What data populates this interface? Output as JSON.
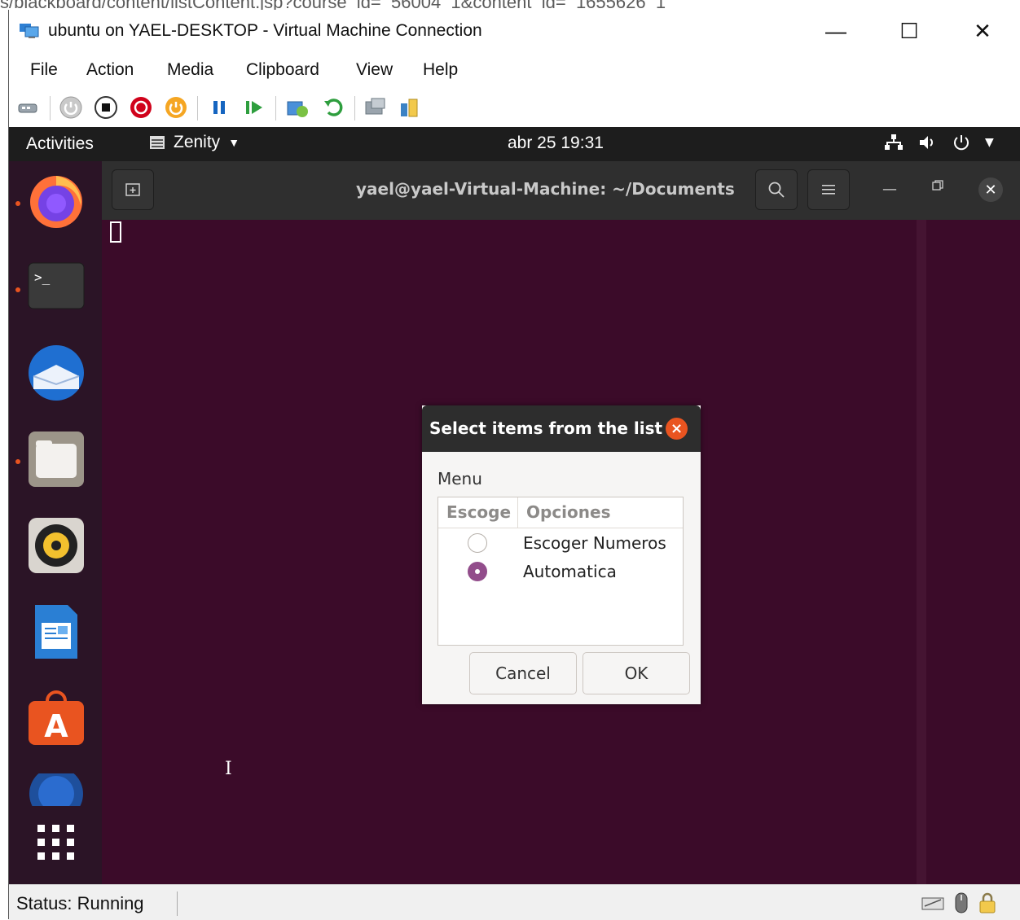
{
  "behind_window": {
    "url_fragment": "s/blackboard/content/listContent.jsp?course_id=_56004_1&content_id=_1655626_1"
  },
  "vm_window": {
    "title": "ubuntu on YAEL-DESKTOP - Virtual Machine Connection",
    "caption_buttons": {
      "minimize": "—",
      "maximize": "☐",
      "close": "✕"
    },
    "menu": [
      "File",
      "Action",
      "Media",
      "Clipboard",
      "View",
      "Help"
    ],
    "toolbar_icons": [
      "ctrl-alt-del-icon",
      "start-icon",
      "turn-off-icon",
      "shut-down-icon",
      "save-icon",
      "pause-icon",
      "resume-icon",
      "checkpoint-icon",
      "revert-icon",
      "enhanced-session-icon",
      "share-icon"
    ],
    "status": "Status: Running"
  },
  "ubuntu": {
    "topbar": {
      "activities": "Activities",
      "app_menu": "Zenity",
      "clock": "abr 25  19:31"
    },
    "dock": [
      "firefox",
      "terminal",
      "thunderbird",
      "files",
      "rhythmbox",
      "libreoffice-writer",
      "ubuntu-software",
      "help",
      "show-applications"
    ],
    "terminal": {
      "title": "yael@yael-Virtual-Machine: ~/Documents"
    },
    "dialog": {
      "title": "Select items from the list",
      "label": "Menu",
      "columns": [
        "Escoge",
        "Opciones"
      ],
      "rows": [
        {
          "label": "Escoger Numeros",
          "selected": false
        },
        {
          "label": "Automatica",
          "selected": true
        }
      ],
      "cancel": "Cancel",
      "ok": "OK"
    }
  },
  "colors": {
    "ubuntu_orange": "#e95420",
    "terminal_bg": "#3b0b29",
    "radio_selected": "#924d8b"
  }
}
